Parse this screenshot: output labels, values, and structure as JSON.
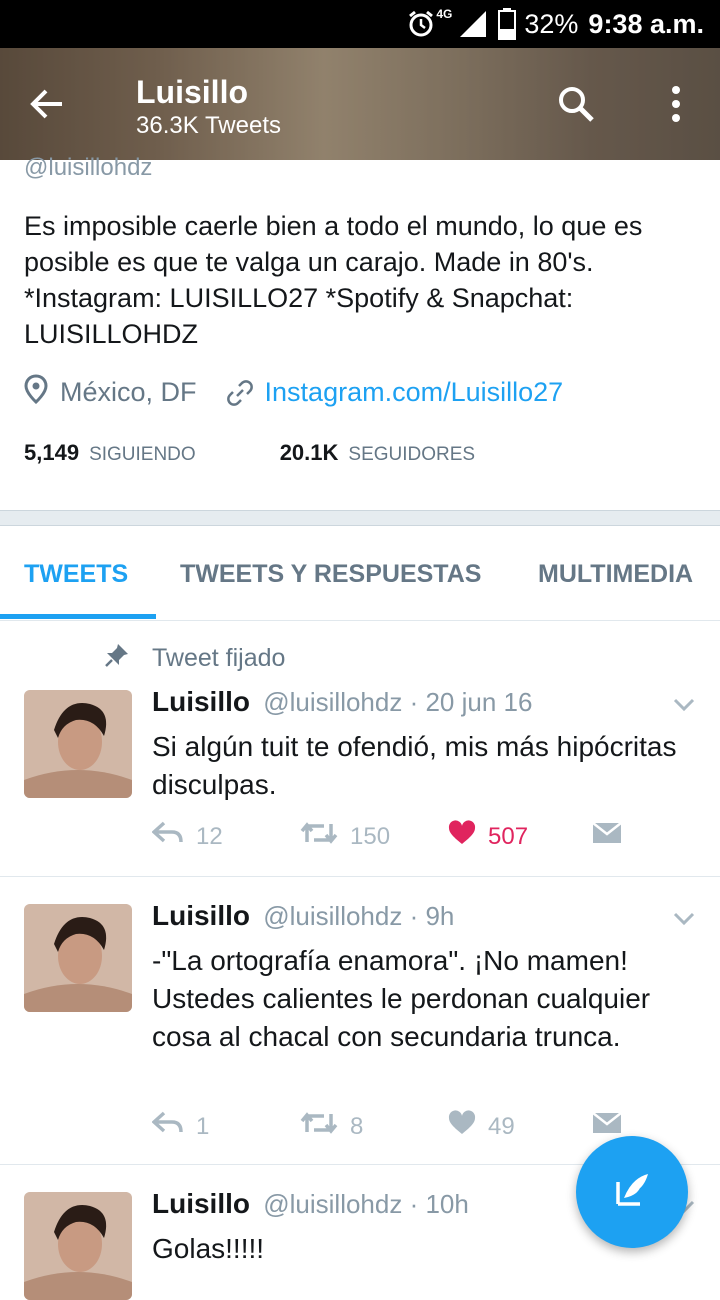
{
  "status_bar": {
    "network": "4G",
    "battery": "32%",
    "time": "9:38 a.m."
  },
  "header": {
    "name": "Luisillo",
    "tweet_count": "36.3K Tweets"
  },
  "profile": {
    "handle": "@luisillohdz",
    "bio": "Es imposible caerle bien a todo el mundo, lo que es posible es que te valga un carajo. Made in 80's. *Instagram: LUISILLO27 *Spotify & Snapchat: LUISILLOHDZ",
    "location": "México, DF",
    "link": "Instagram.com/Luisillo27",
    "following_count": "5,149",
    "following_label": "SIGUIENDO",
    "followers_count": "20.1K",
    "followers_label": "SEGUIDORES"
  },
  "tabs": [
    {
      "label": "TWEETS",
      "active": true
    },
    {
      "label": "TWEETS Y RESPUESTAS",
      "active": false
    },
    {
      "label": "MULTIMEDIA",
      "active": false
    }
  ],
  "pinned_label": "Tweet fijado",
  "tweets": [
    {
      "name": "Luisillo",
      "meta": "@luisillohdz · 20 jun 16",
      "text": "Si algún tuit te ofendió, mis más hipócritas disculpas.",
      "replies": "12",
      "retweets": "150",
      "likes": "507",
      "liked": true
    },
    {
      "name": "Luisillo",
      "meta": "@luisillohdz · 9h",
      "text": "-\"La ortografía enamora\". ¡No mamen! Ustedes calientes le perdonan cualquier cosa al chacal con secundaria trunca.",
      "replies": "1",
      "retweets": "8",
      "likes": "49",
      "liked": false
    },
    {
      "name": "Luisillo",
      "meta": "@luisillohdz · 10h",
      "text": "Golas!!!!!",
      "replies": "",
      "retweets": "",
      "likes": "",
      "liked": false
    }
  ],
  "colors": {
    "accent": "#1da1f2",
    "like": "#e0245e",
    "muted": "#657786"
  },
  "icons": [
    "back-arrow-icon",
    "search-icon",
    "more-vert-icon",
    "location-pin-icon",
    "link-icon",
    "pin-icon",
    "reply-icon",
    "retweet-icon",
    "heart-icon",
    "dm-icon",
    "chevron-down-icon",
    "compose-icon"
  ]
}
